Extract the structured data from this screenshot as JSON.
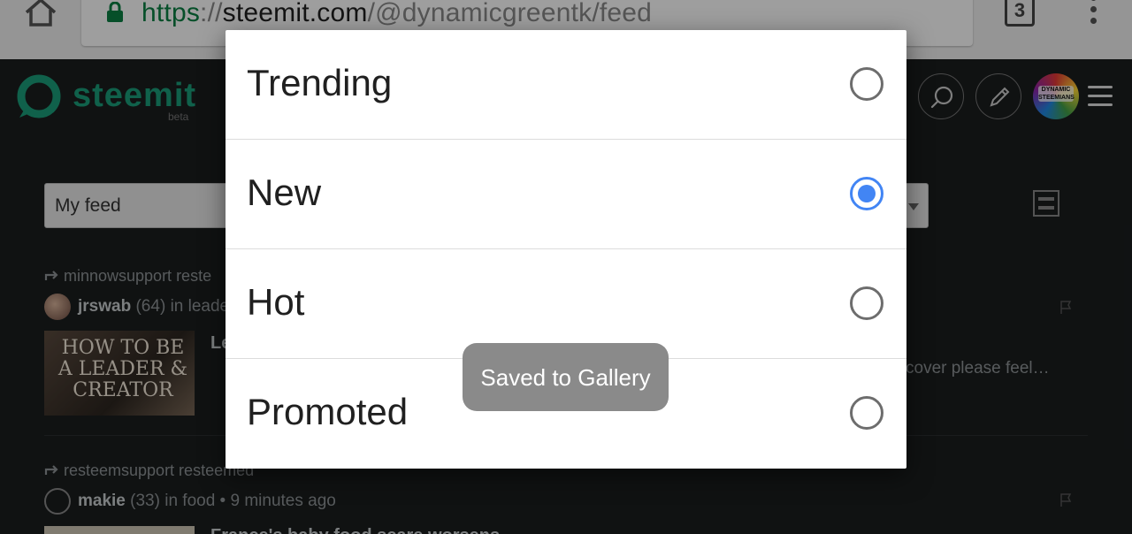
{
  "browser": {
    "url": {
      "protocol": "https",
      "separator": "://",
      "host": "steemit.com",
      "path": "/@dynamicgreentk/feed"
    },
    "tab_count": "3"
  },
  "site": {
    "logo_text": "steemit",
    "beta_label": "beta",
    "avatar_text": "DYNAMIC STEEMIANS"
  },
  "feed": {
    "select_value": "My feed",
    "posts": [
      {
        "resteem_text": "minnowsupport reste",
        "author": "jrswab",
        "reputation": "(64)",
        "meta": "in leader",
        "thumb_text": "HOW TO BE A LEADER & CREATOR",
        "title_peek": "Le",
        "summary_peek": "cover please feel…"
      },
      {
        "resteem_text": "resteemsupport resteemed",
        "author": "makie",
        "reputation": "(33)",
        "meta": "in food • 9 minutes ago",
        "title_peek": "France's baby food scare worsens"
      }
    ]
  },
  "dialog": {
    "options": [
      {
        "label": "Trending",
        "selected": false
      },
      {
        "label": "New",
        "selected": true
      },
      {
        "label": "Hot",
        "selected": false
      },
      {
        "label": "Promoted",
        "selected": false
      }
    ]
  },
  "toast": {
    "text": "Saved to Gallery"
  },
  "colors": {
    "accent": "#4285f4",
    "brand": "#1a9d79",
    "url_secure": "#0b8043"
  },
  "icons": [
    "home-icon",
    "lock-icon",
    "tabs-icon",
    "overflow-menu-icon",
    "steemit-logo-icon",
    "search-icon",
    "pencil-icon",
    "hamburger-icon",
    "layout-toggle-icon",
    "resteem-icon",
    "flag-icon"
  ]
}
